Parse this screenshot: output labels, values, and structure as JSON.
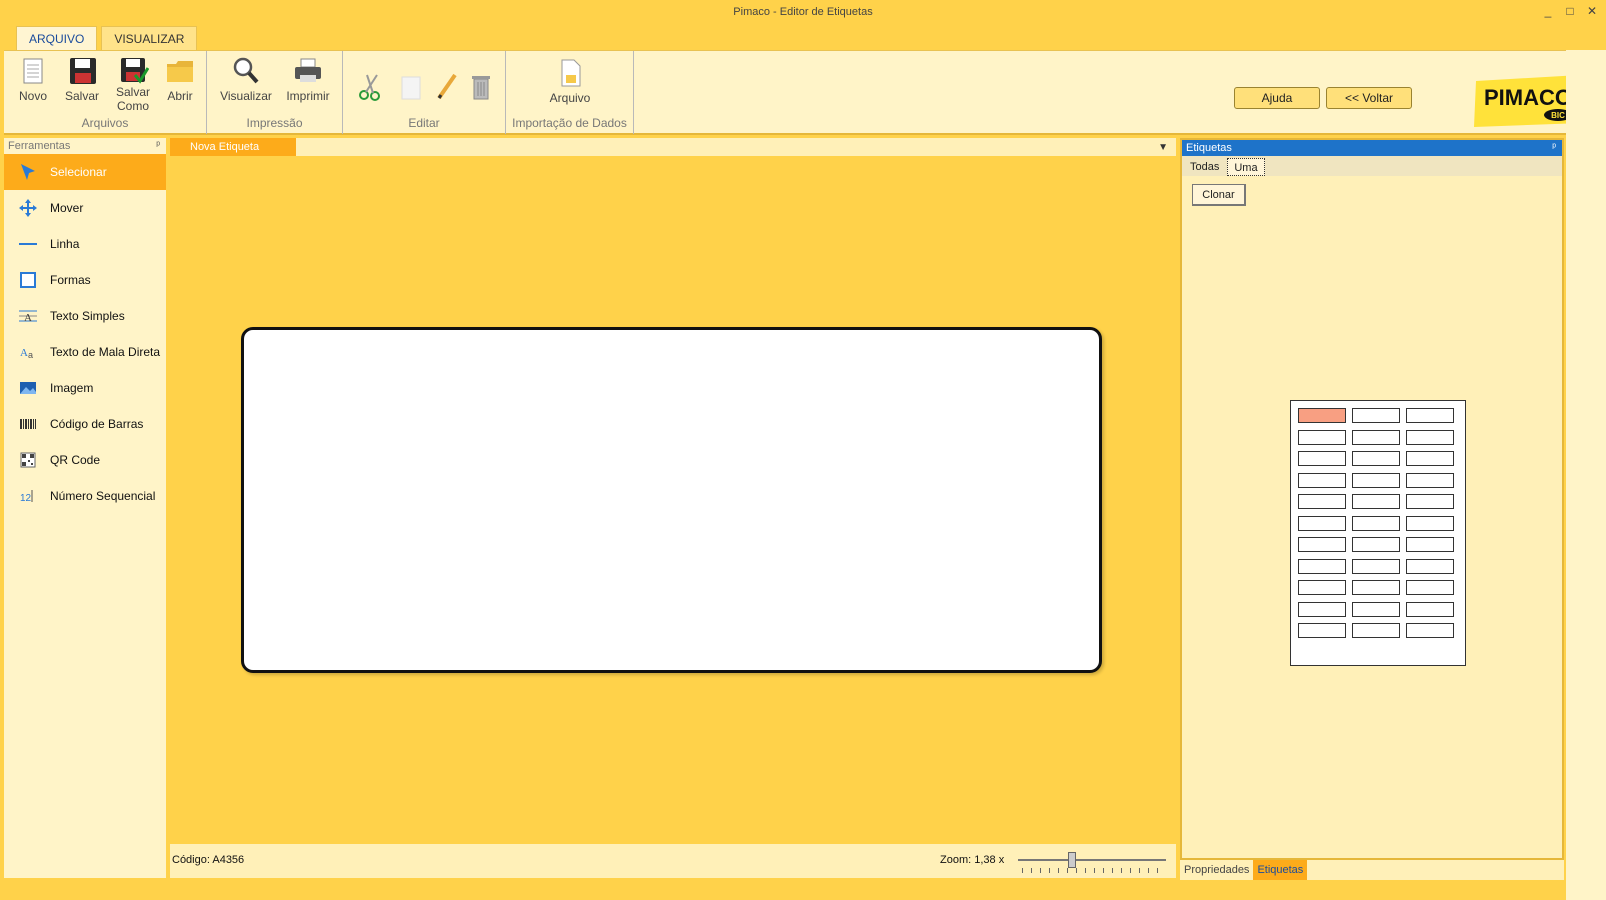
{
  "window": {
    "title": "Pimaco - Editor de Etiquetas",
    "minimize": "_",
    "maximize": "□",
    "close": "✕"
  },
  "ribbon_tabs": [
    {
      "label": "ARQUIVO",
      "active": true
    },
    {
      "label": "VISUALIZAR",
      "active": false
    }
  ],
  "ribbon": {
    "groups": {
      "arquivos": {
        "label": "Arquivos",
        "buttons": {
          "novo": "Novo",
          "salvar": "Salvar",
          "salvar_como_1": "Salvar",
          "salvar_como_2": "Como",
          "abrir": "Abrir"
        }
      },
      "impressao": {
        "label": "Impressão",
        "buttons": {
          "visualizar": "Visualizar",
          "imprimir": "Imprimir"
        }
      },
      "editar": {
        "label": "Editar"
      },
      "importacao": {
        "label": "Importação de Dados",
        "buttons": {
          "arquivo": "Arquivo"
        }
      }
    },
    "ajuda": "Ajuda",
    "voltar": "<< Voltar",
    "logo": {
      "brand": "PIMACO",
      "sub": "BIC"
    }
  },
  "tools": {
    "title": "Ferramentas",
    "pin": "ᵖ",
    "items": [
      {
        "label": "Selecionar",
        "icon": "cursor-icon",
        "active": true
      },
      {
        "label": "Mover",
        "icon": "move-icon"
      },
      {
        "label": "Linha",
        "icon": "line-icon"
      },
      {
        "label": "Formas",
        "icon": "shape-icon"
      },
      {
        "label": "Texto Simples",
        "icon": "text-icon"
      },
      {
        "label": "Texto de Mala Direta",
        "icon": "mail-merge-text-icon"
      },
      {
        "label": "Imagem",
        "icon": "image-icon"
      },
      {
        "label": "Código de Barras",
        "icon": "barcode-icon"
      },
      {
        "label": "QR Code",
        "icon": "qr-code-icon"
      },
      {
        "label": "Número Sequencial",
        "icon": "sequence-number-icon"
      }
    ]
  },
  "document": {
    "tab": "Nova Etiqueta",
    "dropdown": "▼",
    "code": "Código: A4356",
    "zoom": "Zoom: 1,38 x",
    "zoom_value": 1.38
  },
  "etiquetas": {
    "title": "Etiquetas",
    "pin": "ᵖ",
    "tabs": [
      {
        "label": "Todas",
        "active": false
      },
      {
        "label": "Uma",
        "active": true
      }
    ],
    "clonar": "Clonar",
    "sheet": {
      "columns": 3,
      "rows": 11,
      "selected_row": 0,
      "selected_col": 0
    }
  },
  "bottom_tabs": [
    {
      "label": "Propriedades",
      "active": false
    },
    {
      "label": "Etiquetas",
      "active": true
    }
  ],
  "colors": {
    "accent": "#fdab1a",
    "background": "#ffd24a",
    "panel": "#fff4c8",
    "selected_cell": "#f89f82",
    "panel_header": "#1e73c9"
  }
}
